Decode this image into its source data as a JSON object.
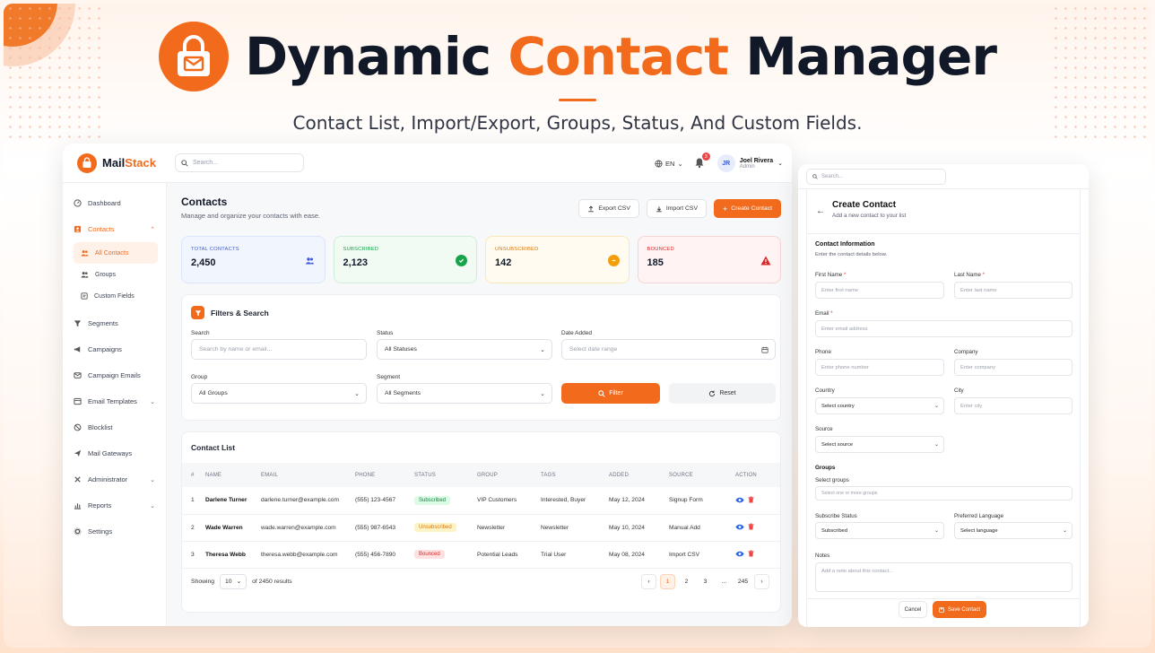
{
  "hero": {
    "title_part1": "Dynamic",
    "title_part2": "Contact",
    "title_part3": "Manager",
    "subtitle": "Contact List, Import/Export, Groups, Status, And Custom Fields."
  },
  "colors": {
    "accent": "#f26b1d",
    "success": "#16a34a",
    "warning": "#f59e0b",
    "danger": "#ef4444",
    "info": "#3b5bdb"
  },
  "app": {
    "brand_part1": "Mail",
    "brand_part2": "Stack",
    "search_placeholder": "Search...",
    "language": "EN",
    "notification_count": "3",
    "user": {
      "initials": "JR",
      "name": "Joel Rivera",
      "role": "Admin"
    }
  },
  "sidebar": {
    "items": [
      {
        "label": "Dashboard",
        "icon": "dashboard-icon"
      },
      {
        "label": "Contacts",
        "icon": "contacts-icon"
      },
      {
        "label": "All Contacts",
        "icon": "users-icon"
      },
      {
        "label": "Groups",
        "icon": "group-icon"
      },
      {
        "label": "Custom Fields",
        "icon": "fields-icon"
      },
      {
        "label": "Segments",
        "icon": "filter-icon"
      },
      {
        "label": "Campaigns",
        "icon": "megaphone-icon"
      },
      {
        "label": "Campaign Emails",
        "icon": "mail-icon"
      },
      {
        "label": "Email Templates",
        "icon": "template-icon"
      },
      {
        "label": "Blocklist",
        "icon": "block-icon"
      },
      {
        "label": "Mail Gateways",
        "icon": "send-icon"
      },
      {
        "label": "Administrator",
        "icon": "admin-icon"
      },
      {
        "label": "Reports",
        "icon": "chart-icon"
      },
      {
        "label": "Settings",
        "icon": "gear-icon"
      }
    ]
  },
  "contacts_page": {
    "title": "Contacts",
    "description": "Manage and organize your contacts with ease.",
    "export_label": "Export CSV",
    "import_label": "Import CSV",
    "create_label": "Create Contact"
  },
  "stats": [
    {
      "label": "TOTAL CONTACTS",
      "value": "2,450",
      "icon": "users-icon"
    },
    {
      "label": "SUBSCRIBED",
      "value": "2,123",
      "icon": "check-circle-icon"
    },
    {
      "label": "UNSUBSCRIBED",
      "value": "142",
      "icon": "minus-circle-icon"
    },
    {
      "label": "BOUNCED",
      "value": "185",
      "icon": "warning-icon"
    }
  ],
  "filters": {
    "title": "Filters & Search",
    "search_label": "Search",
    "search_placeholder": "Search by name or email...",
    "status_label": "Status",
    "status_value": "All Statuses",
    "date_label": "Date Added",
    "date_placeholder": "Select date range",
    "group_label": "Group",
    "group_value": "All Groups",
    "segment_label": "Segment",
    "segment_value": "All Segments",
    "filter_button": "Filter",
    "reset_button": "Reset"
  },
  "contact_list": {
    "title": "Contact List",
    "columns": [
      "#",
      "NAME",
      "EMAIL",
      "PHONE",
      "STATUS",
      "GROUP",
      "TAGS",
      "ADDED",
      "SOURCE",
      "ACTION"
    ],
    "rows": [
      {
        "num": "1",
        "name": "Darlene Turner",
        "email": "darlene.turner@example.com",
        "phone": "(555) 123-4567",
        "status": "Subscribed",
        "group": "VIP Customers",
        "tags": "Interested, Buyer",
        "added": "May 12, 2024",
        "source": "Signup Form"
      },
      {
        "num": "2",
        "name": "Wade Warren",
        "email": "wade.warren@example.com",
        "phone": "(555) 987-6543",
        "status": "Unsubscribed",
        "group": "Newsletter",
        "tags": "Newsletter",
        "added": "May 10, 2024",
        "source": "Manual Add"
      },
      {
        "num": "3",
        "name": "Theresa Webb",
        "email": "theresa.webb@example.com",
        "phone": "(555) 456-7890",
        "status": "Bounced",
        "group": "Potential Leads",
        "tags": "Trial User",
        "added": "May 08, 2024",
        "source": "Import CSV"
      }
    ],
    "showing_label": "Showing",
    "page_size": "10",
    "results_label": "of 2450 results",
    "pages": [
      "1",
      "2",
      "3",
      "...",
      "245"
    ]
  },
  "create_form": {
    "search_placeholder": "Search...",
    "title": "Create Contact",
    "description": "Add a new contact to your list",
    "section_title": "Contact Information",
    "section_desc": "Enter the contact details below.",
    "first_name_label": "First Name",
    "first_name_ph": "Enter first name",
    "last_name_label": "Last Name",
    "last_name_ph": "Enter last name",
    "email_label": "Email",
    "email_ph": "Enter email address",
    "phone_label": "Phone",
    "phone_ph": "Enter phone number",
    "company_label": "Company",
    "company_ph": "Enter company",
    "country_label": "Country",
    "country_value": "Select country",
    "city_label": "City",
    "city_ph": "Enter city",
    "source_label": "Source",
    "source_value": "Select source",
    "groups_title": "Groups",
    "groups_label": "Select groups",
    "groups_ph": "Select one or more groups",
    "status_label": "Subscribe Status",
    "status_value": "Subscribed",
    "lang_label": "Preferred Language",
    "lang_value": "Select language",
    "notes_label": "Notes",
    "notes_ph": "Add a note about this contact...",
    "cancel": "Cancel",
    "save": "Save Contact"
  }
}
